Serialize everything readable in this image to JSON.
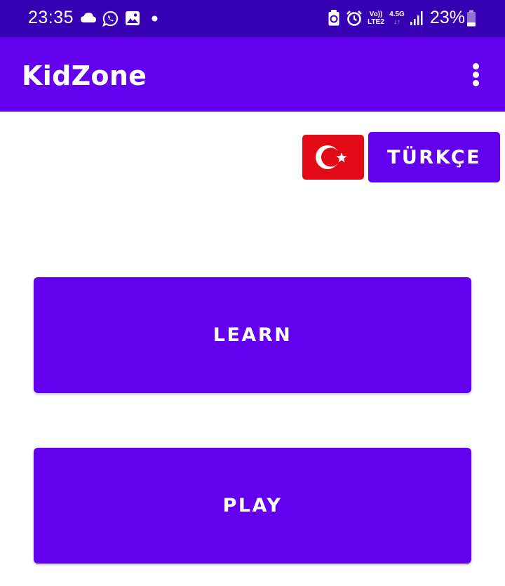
{
  "status_bar": {
    "time": "23:35",
    "icons_left": [
      "cloud-icon",
      "whatsapp-icon",
      "gallery-icon",
      "dot-icon"
    ],
    "icons_right": [
      "recycle-icon",
      "alarm-icon",
      "volte-lte2-icon",
      "network-4-5g-icon",
      "signal-icon",
      "battery-icon"
    ],
    "volte_top": "Vo))",
    "volte_bottom": "LTE2",
    "net_type": "4.5G",
    "battery": "23%"
  },
  "app_bar": {
    "title": "KidZone",
    "menu_icon": "more-vert-icon"
  },
  "language": {
    "flag_icon": "turkey-flag-icon",
    "label": "TÜRKÇE"
  },
  "main": {
    "learn_label": "LEARN",
    "play_label": "PLAY"
  },
  "colors": {
    "status_bar": "#3700b3",
    "primary": "#6200ee",
    "flag_red": "#e30a17",
    "background": "#ffffff"
  }
}
